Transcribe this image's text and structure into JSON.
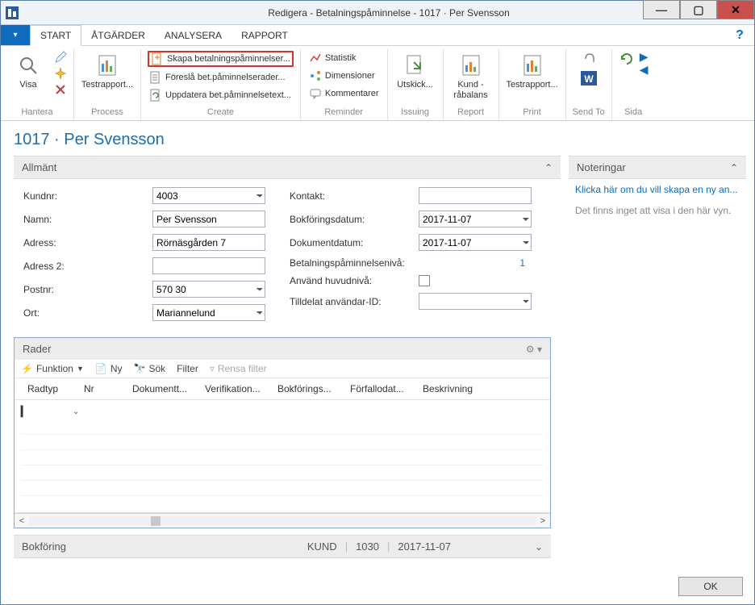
{
  "window": {
    "title": "Redigera - Betalningspåminnelse - 1017 · Per Svensson"
  },
  "menu": {
    "items": [
      "START",
      "ÅTGÄRDER",
      "ANALYSERA",
      "RAPPORT"
    ]
  },
  "ribbon": {
    "hantera": {
      "label": "Hantera",
      "visa": "Visa"
    },
    "process": {
      "label": "Process",
      "testrapport": "Testrapport..."
    },
    "create": {
      "label": "Create",
      "skapa": "Skapa betalningspåminnelser...",
      "foresla": "Föreslå bet.påminnelserader...",
      "uppdatera": "Uppdatera bet.påminnelsetext..."
    },
    "reminder": {
      "label": "Reminder",
      "statistik": "Statistik",
      "dimensioner": "Dimensioner",
      "kommentarer": "Kommentarer"
    },
    "issuing": {
      "label": "Issuing",
      "utskick": "Utskick..."
    },
    "report": {
      "label": "Report",
      "kund": "Kund - råbalans"
    },
    "print": {
      "label": "Print",
      "testrapport": "Testrapport..."
    },
    "sendto": {
      "label": "Send To"
    },
    "sida": {
      "label": "Sida"
    }
  },
  "page": {
    "title": "1017 · Per Svensson"
  },
  "allmant": {
    "header": "Allmänt",
    "kundnr_label": "Kundnr:",
    "kundnr": "4003",
    "namn_label": "Namn:",
    "namn": "Per Svensson",
    "adress_label": "Adress:",
    "adress": "Rörnäsgården 7",
    "adress2_label": "Adress 2:",
    "adress2": "",
    "postnr_label": "Postnr:",
    "postnr": "570 30",
    "ort_label": "Ort:",
    "ort": "Mariannelund",
    "kontakt_label": "Kontakt:",
    "kontakt": "",
    "bokfdatum_label": "Bokföringsdatum:",
    "bokfdatum": "2017-11-07",
    "dokdatum_label": "Dokumentdatum:",
    "dokdatum": "2017-11-07",
    "niva_label": "Betalningspåminnelsenivå:",
    "niva": "1",
    "huvudniva_label": "Använd huvudnivå:",
    "anvandarid_label": "Tilldelat användar-ID:",
    "anvandarid": ""
  },
  "rader": {
    "header": "Rader",
    "toolbar": {
      "funktion": "Funktion",
      "ny": "Ny",
      "sok": "Sök",
      "filter": "Filter",
      "rensa": "Rensa filter"
    },
    "columns": [
      "Radtyp",
      "Nr",
      "Dokumentt...",
      "Verifikation...",
      "Bokförings...",
      "Förfallodat...",
      "Beskrivning"
    ]
  },
  "status": {
    "label": "Bokföring",
    "kund": "KUND",
    "id": "1030",
    "date": "2017-11-07"
  },
  "notes": {
    "header": "Noteringar",
    "link": "Klicka här om du vill skapa en ny an...",
    "empty": "Det finns inget att visa i den här vyn."
  },
  "footer": {
    "ok": "OK"
  }
}
